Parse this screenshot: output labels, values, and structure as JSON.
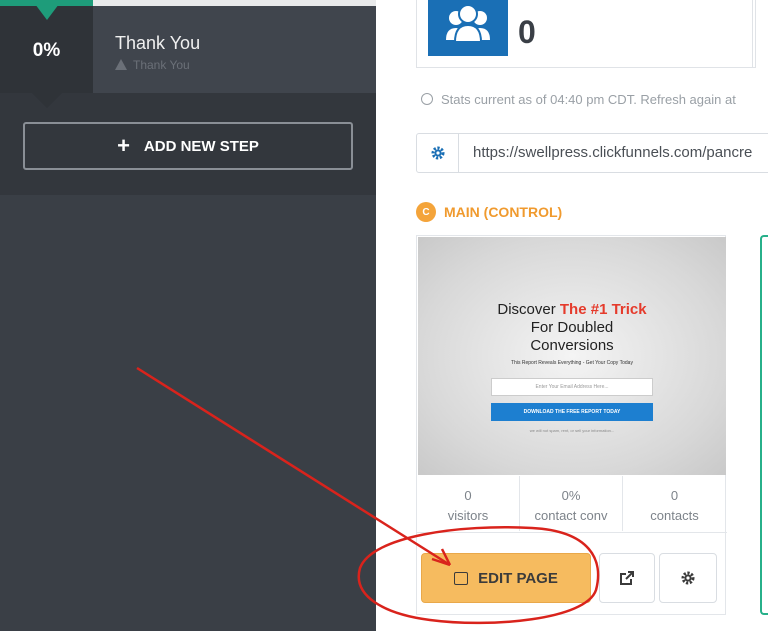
{
  "funnel_step": {
    "percent": "0%",
    "title": "Thank You",
    "subtitle": "Thank You",
    "add_step_label": "ADD NEW STEP"
  },
  "stats": {
    "value": "0",
    "current_text": "Stats current as of 04:40 pm CDT. Refresh again at"
  },
  "url_bar": {
    "url": "https://swellpress.clickfunnels.com/pancre"
  },
  "variant": {
    "badge": "C",
    "title": "MAIN (CONTROL)",
    "preview": {
      "headline_prefix": "Discover ",
      "headline_highlight": "The #1 Trick",
      "headline_rest_1": "For Doubled",
      "headline_rest_2": "Conversions",
      "subtext": "This Report Reveals Everything - Get Your Copy Today",
      "input_placeholder": "Enter Your Email Address Here...",
      "button": "DOWNLOAD THE FREE REPORT TODAY",
      "note": "we will not spam, rent, or sell your information..."
    },
    "metrics": [
      {
        "value": "0",
        "label": "visitors"
      },
      {
        "value": "0%",
        "label": "contact conv"
      },
      {
        "value": "0",
        "label": "contacts"
      }
    ],
    "edit_label": "EDIT PAGE"
  },
  "colors": {
    "sidebar_bg": "#3a3f46",
    "accent_green": "#1e9c7a",
    "accent_orange": "#f09a2e",
    "edit_button": "#f6bb5f",
    "annotation_red": "#d9231c"
  },
  "icons": {
    "step_warning": "warning-icon",
    "add": "plus-icon",
    "stats_card": "users-icon",
    "stats_time": "clock-icon",
    "url_settings": "gear-icon",
    "edit": "edit-icon",
    "open": "external-link-icon",
    "settings": "gear-icon"
  }
}
